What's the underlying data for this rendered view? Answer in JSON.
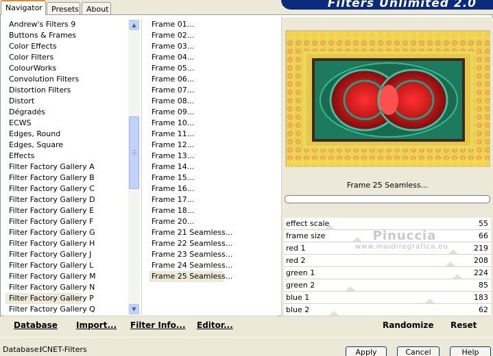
{
  "tabs": [
    {
      "label": "Navigator",
      "active": true
    },
    {
      "label": "Presets",
      "active": false
    },
    {
      "label": "About",
      "active": false
    }
  ],
  "app_title": "Filters Unlimited 2.0",
  "categories": {
    "items": [
      "Andrew's Filters 9",
      "Buttons & Frames",
      "Color Effects",
      "Color Filters",
      "ColourWorks",
      "Convolution Filters",
      "Distortion Filters",
      "Distort",
      "Dégradés",
      "ECWS",
      "Edges, Round",
      "Edges, Square",
      "Effects",
      "Filter Factory Gallery A",
      "Filter Factory Gallery B",
      "Filter Factory Gallery C",
      "Filter Factory Gallery D",
      "Filter Factory Gallery E",
      "Filter Factory Gallery F",
      "Filter Factory Gallery G",
      "Filter Factory Gallery H",
      "Filter Factory Gallery J",
      "Filter Factory Gallery L",
      "Filter Factory Gallery M",
      "Filter Factory Gallery N",
      "Filter Factory Gallery P",
      "Filter Factory Gallery Q"
    ],
    "selected": "Filter Factory Gallery P"
  },
  "filters": {
    "items": [
      "Frame 01...",
      "Frame 02...",
      "Frame 03...",
      "Frame 04...",
      "Frame 05...",
      "Frame 06...",
      "Frame 07...",
      "Frame 08...",
      "Frame 09...",
      "Frame 10...",
      "Frame 11...",
      "Frame 12...",
      "Frame 13...",
      "Frame 14...",
      "Frame 15...",
      "Frame 16...",
      "Frame 17...",
      "Frame 18...",
      "Frame 20...",
      "Frame 21 Seamless...",
      "Frame 22 Seamless...",
      "Frame 23 Seamless...",
      "Frame 24 Seamless...",
      "Frame 25 Seamless..."
    ],
    "selected": "Frame 25 Seamless..."
  },
  "preview_caption": "Frame 25 Seamless...",
  "sliders": [
    {
      "label": "effect scale",
      "value": "55"
    },
    {
      "label": "frame size",
      "value": "66"
    },
    {
      "label": "red 1",
      "value": "219"
    },
    {
      "label": "red 2",
      "value": "208"
    },
    {
      "label": "green 1",
      "value": "224"
    },
    {
      "label": "green 2",
      "value": "85"
    },
    {
      "label": "blue 1",
      "value": "183"
    },
    {
      "label": "blue 2",
      "value": "62"
    }
  ],
  "bottom_buttons": {
    "database": "Database",
    "import": "Import...",
    "filter_info": "Filter Info...",
    "editor": "Editor...",
    "randomize": "Randomize",
    "reset": "Reset"
  },
  "status": {
    "database_label": "Database:",
    "database_value": "ICNET-Filters"
  },
  "footer_buttons": {
    "apply": "Apply",
    "cancel": "Cancel",
    "help": "Help"
  },
  "watermark": {
    "name": "Pinuccia",
    "url": "www.maidiregrafica.eu"
  },
  "colors": {
    "accent_tab": "#e68b2c",
    "banner": "#0a2a7a",
    "window_bg": "#ece9d8"
  }
}
